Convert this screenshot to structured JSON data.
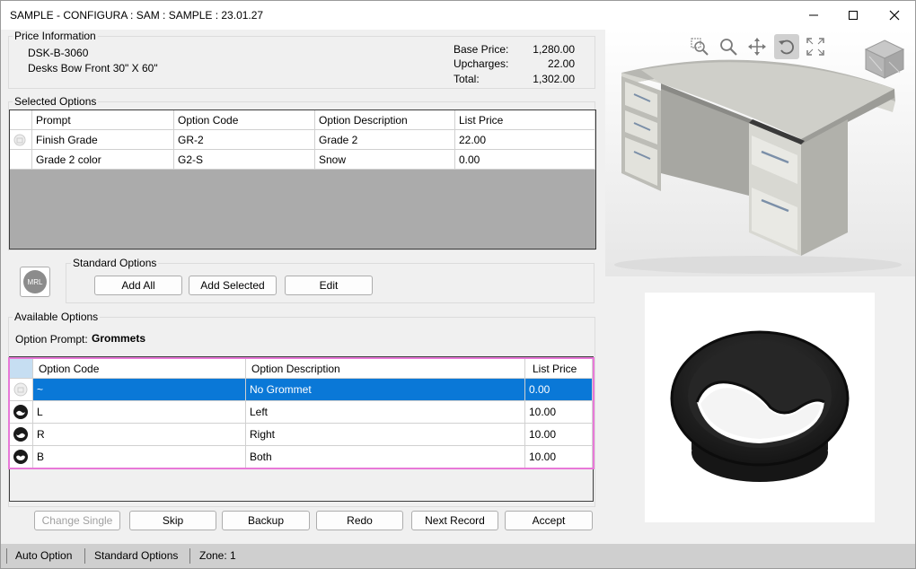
{
  "window": {
    "title": "SAMPLE - CONFIGURA : SAM : SAMPLE : 23.01.27"
  },
  "price_info": {
    "group_label": "Price Information",
    "product_code": "DSK-B-3060",
    "product_desc": "Desks Bow Front 30\" X 60\"",
    "base_price_label": "Base Price:",
    "base_price": "1,280.00",
    "upcharges_label": "Upcharges:",
    "upcharges": "22.00",
    "total_label": "Total:",
    "total": "1,302.00"
  },
  "selected_options": {
    "group_label": "Selected Options",
    "columns": [
      "Prompt",
      "Option Code",
      "Option Description",
      "List Price"
    ],
    "rows": [
      {
        "prompt": "Finish Grade",
        "code": "GR-2",
        "desc": "Grade 2",
        "price": "22.00"
      },
      {
        "prompt": "Grade 2 color",
        "code": "G2-S",
        "desc": "Snow",
        "price": "0.00"
      }
    ]
  },
  "standard_options": {
    "group_label": "Standard Options",
    "logo_text": "MRL",
    "add_all": "Add All",
    "add_selected": "Add Selected",
    "edit": "Edit"
  },
  "available_options": {
    "group_label": "Available Options",
    "prompt_label": "Option Prompt:",
    "prompt_value": "Grommets",
    "columns": [
      "Option Code",
      "Option Description",
      "List Price"
    ],
    "rows": [
      {
        "code": "~",
        "desc": "No Grommet",
        "price": "0.00"
      },
      {
        "code": "L",
        "desc": "Left",
        "price": "10.00"
      },
      {
        "code": "R",
        "desc": "Right",
        "price": "10.00"
      },
      {
        "code": "B",
        "desc": "Both",
        "price": "10.00"
      }
    ]
  },
  "actions": {
    "change_single": "Change Single",
    "skip": "Skip",
    "backup": "Backup",
    "redo": "Redo",
    "next_record": "Next Record",
    "accept": "Accept"
  },
  "status": {
    "auto_option": "Auto Option",
    "standard_options": "Standard Options",
    "zone": "Zone: 1"
  },
  "colors": {
    "selection": "#0a78d7",
    "highlight_border": "#e879d8",
    "statusbar": "#cfcfcf"
  }
}
